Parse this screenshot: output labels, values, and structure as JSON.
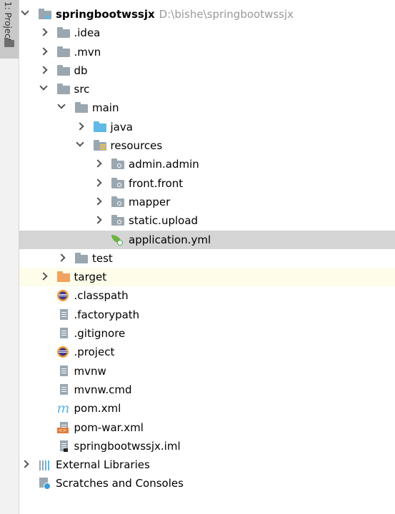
{
  "sidebar": {
    "tab_label": "1: Project"
  },
  "tree": [
    {
      "label": "springbootwssjx",
      "path": "D:\\bishe\\springbootwssjx",
      "depth": 0,
      "chevron": "down",
      "icon": "module-folder-icon",
      "bold": true
    },
    {
      "label": ".idea",
      "depth": 1,
      "chevron": "right",
      "icon": "folder-icon"
    },
    {
      "label": ".mvn",
      "depth": 1,
      "chevron": "right",
      "icon": "folder-icon"
    },
    {
      "label": "db",
      "depth": 1,
      "chevron": "right",
      "icon": "folder-icon"
    },
    {
      "label": "src",
      "depth": 1,
      "chevron": "down",
      "icon": "folder-icon"
    },
    {
      "label": "main",
      "depth": 2,
      "chevron": "down",
      "icon": "folder-icon"
    },
    {
      "label": "java",
      "depth": 3,
      "chevron": "right",
      "icon": "source-folder-icon"
    },
    {
      "label": "resources",
      "depth": 3,
      "chevron": "down",
      "icon": "resources-folder-icon"
    },
    {
      "label": "admin.admin",
      "depth": 4,
      "chevron": "right",
      "icon": "package-folder-icon"
    },
    {
      "label": "front.front",
      "depth": 4,
      "chevron": "right",
      "icon": "package-folder-icon"
    },
    {
      "label": "mapper",
      "depth": 4,
      "chevron": "right",
      "icon": "package-folder-icon"
    },
    {
      "label": "static.upload",
      "depth": 4,
      "chevron": "right",
      "icon": "package-folder-icon"
    },
    {
      "label": "application.yml",
      "depth": 4,
      "chevron": "none",
      "icon": "spring-config-icon",
      "state": "selected"
    },
    {
      "label": "test",
      "depth": 2,
      "chevron": "right",
      "icon": "folder-icon"
    },
    {
      "label": "target",
      "depth": 1,
      "chevron": "right",
      "icon": "excluded-folder-icon",
      "state": "highlight"
    },
    {
      "label": ".classpath",
      "depth": 1,
      "chevron": "none",
      "icon": "eclipse-icon"
    },
    {
      "label": ".factorypath",
      "depth": 1,
      "chevron": "none",
      "icon": "file-icon"
    },
    {
      "label": ".gitignore",
      "depth": 1,
      "chevron": "none",
      "icon": "file-icon"
    },
    {
      "label": ".project",
      "depth": 1,
      "chevron": "none",
      "icon": "eclipse-icon"
    },
    {
      "label": "mvnw",
      "depth": 1,
      "chevron": "none",
      "icon": "file-icon"
    },
    {
      "label": "mvnw.cmd",
      "depth": 1,
      "chevron": "none",
      "icon": "file-icon"
    },
    {
      "label": "pom.xml",
      "depth": 1,
      "chevron": "none",
      "icon": "maven-icon"
    },
    {
      "label": "pom-war.xml",
      "depth": 1,
      "chevron": "none",
      "icon": "xml-file-icon"
    },
    {
      "label": "springbootwssjx.iml",
      "depth": 1,
      "chevron": "none",
      "icon": "iml-file-icon"
    },
    {
      "label": "External Libraries",
      "depth": 0,
      "chevron": "right",
      "icon": "libraries-icon"
    },
    {
      "label": "Scratches and Consoles",
      "depth": 0,
      "chevron": "none",
      "icon": "scratches-icon"
    }
  ]
}
